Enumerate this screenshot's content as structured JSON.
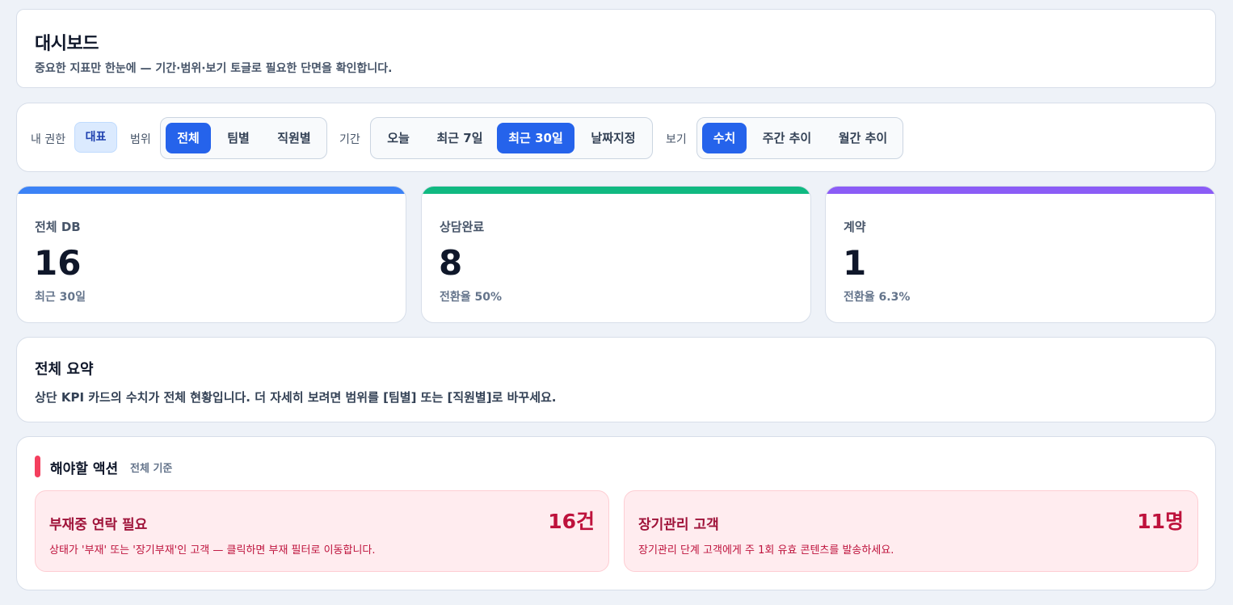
{
  "header": {
    "title": "대시보드",
    "subtitle": "중요한 지표만 한눈에 — 기간·범위·보기 토글로 필요한 단면을 확인합니다."
  },
  "filters": {
    "role_label": "내 권한",
    "role_value": "대표",
    "scope_label": "범위",
    "scope_options": [
      "전체",
      "팀별",
      "직원별"
    ],
    "scope_selected": "전체",
    "period_label": "기간",
    "period_options": [
      "오늘",
      "최근 7일",
      "최근 30일",
      "날짜지정"
    ],
    "period_selected": "최근 30일",
    "view_label": "보기",
    "view_options": [
      "수치",
      "주간 추이",
      "월간 추이"
    ],
    "view_selected": "수치"
  },
  "kpis": [
    {
      "label": "전체 DB",
      "value": "16",
      "sub": "최근 30일",
      "color": "#3b82f6"
    },
    {
      "label": "상담완료",
      "value": "8",
      "sub": "전환율 50%",
      "color": "#10b981"
    },
    {
      "label": "계약",
      "value": "1",
      "sub": "전환율 6.3%",
      "color": "#8b5cf6"
    }
  ],
  "summary": {
    "title": "전체 요약",
    "text": "상단 KPI 카드의 수치가 전체 현황입니다. 더 자세히 보려면 범위를 [팀별] 또는 [직원별]로 바꾸세요."
  },
  "actions": {
    "title": "해야할 액션",
    "scope": "전체 기준",
    "accent_color": "#f43f5e",
    "items": [
      {
        "name": "부재중 연락 필요",
        "count": "16건",
        "desc": "상태가 '부재' 또는 '장기부재'인 고객 — 클릭하면 부재 필터로 이동합니다."
      },
      {
        "name": "장기관리 고객",
        "count": "11명",
        "desc": "장기관리 단계 고객에게 주 1회 유효 콘텐츠를 발송하세요."
      }
    ]
  }
}
